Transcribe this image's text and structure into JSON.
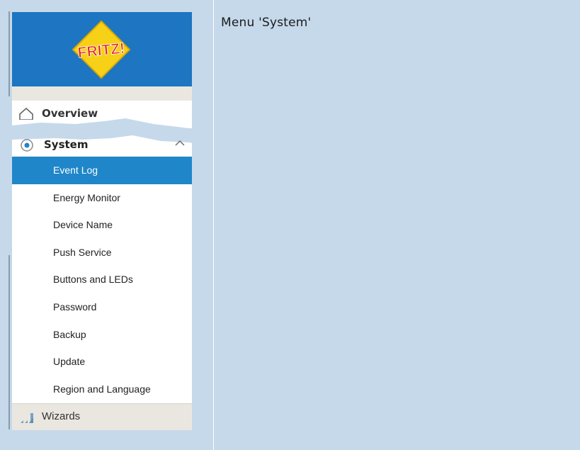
{
  "caption": "Menu 'System'",
  "logo": {
    "text": "FRITZ!",
    "colors": {
      "background": "#1e75c1",
      "diamond": "#f7d117",
      "letters": "#e2231a"
    }
  },
  "nav": {
    "overview_label": "Overview",
    "system_label": "System",
    "system_items": [
      {
        "label": "Event Log",
        "active": true
      },
      {
        "label": "Energy Monitor"
      },
      {
        "label": "Device Name"
      },
      {
        "label": "Push Service"
      },
      {
        "label": "Buttons and LEDs"
      },
      {
        "label": "Password"
      },
      {
        "label": "Backup"
      },
      {
        "label": "Update"
      },
      {
        "label": "Region and Language"
      }
    ],
    "wizards_label": "Wizards",
    "icons": {
      "overview": "house-icon",
      "system": "system-icon",
      "collapse": "chevron-up-icon",
      "wizards": "wizards-icon"
    },
    "colors": {
      "active_item": "#1f86c9",
      "wizards_background": "#eae7e0"
    }
  }
}
